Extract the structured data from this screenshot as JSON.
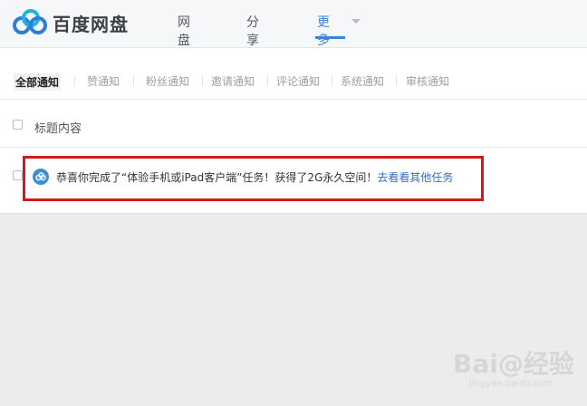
{
  "brand": {
    "name": "百度网盘"
  },
  "nav": {
    "items": [
      "网盘",
      "分享",
      "更多"
    ],
    "active": "更多"
  },
  "tabs": [
    "全部通知",
    "赞通知",
    "粉丝通知",
    "邀请通知",
    "评论通知",
    "系统通知",
    "审核通知"
  ],
  "list_header": {
    "title": "标题内容"
  },
  "notification": {
    "text": "恭喜你完成了“体验手机或iPad客户端”任务！获得了2G永久空间！",
    "link": "去看看其他任务"
  },
  "watermark": {
    "main": "Bai@经验",
    "sub": "jingyan.baidu.com"
  },
  "colors": {
    "accent": "#3a86d4",
    "highlight": "#d01b1b"
  }
}
